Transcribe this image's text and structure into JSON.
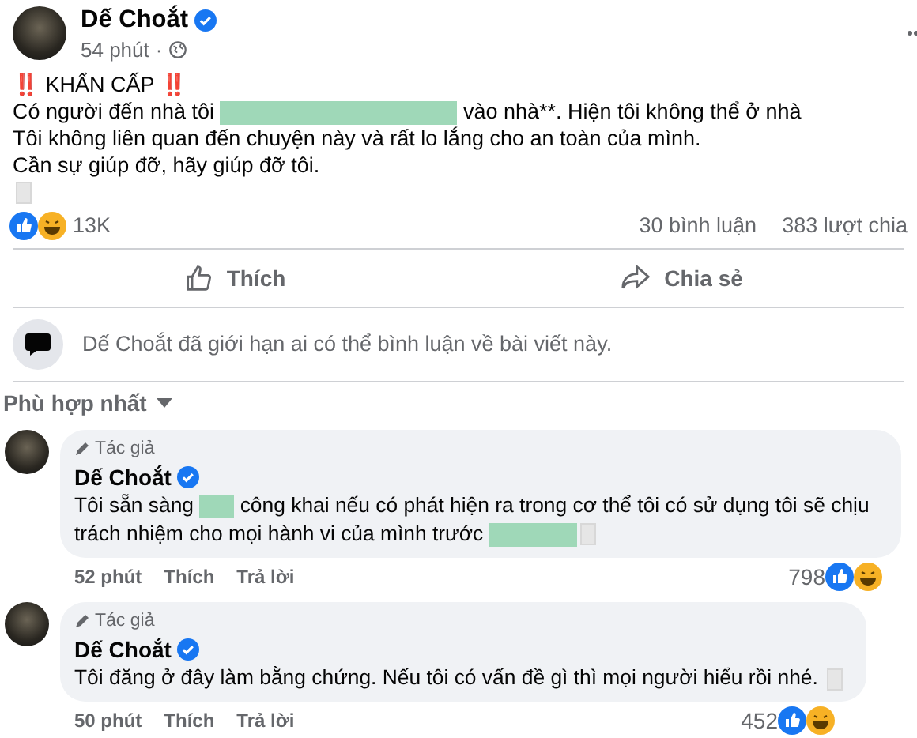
{
  "post": {
    "author": "Dế Choắt",
    "verified": true,
    "time": "54 phút",
    "time_separator": "·",
    "lines": [
      {
        "parts": [
          {
            "kind": "text",
            "text": "‼️ KHẨN CẤP ‼️"
          }
        ]
      },
      {
        "parts": [
          {
            "kind": "text",
            "text": "Có người đến nhà tôi "
          },
          {
            "kind": "redacted"
          },
          {
            "kind": "text",
            "text": " vào nhà**. Hiện tôi không thể ở nhà"
          }
        ]
      },
      {
        "parts": [
          {
            "kind": "text",
            "text": "Tôi không liên quan đến chuyện này và rất lo lắng cho an toàn của mình."
          }
        ]
      },
      {
        "parts": [
          {
            "kind": "text",
            "text": "Cần sự giúp đỡ, hãy giúp đỡ tôi."
          }
        ]
      },
      {
        "parts": [
          {
            "kind": "image"
          }
        ]
      }
    ],
    "reaction_count": "13K",
    "comments_count": "30 bình luận",
    "shares_count": "383 lượt chia",
    "actions": [
      {
        "kind": "like",
        "label": "Thích"
      },
      {
        "kind": "share",
        "label": "Chia sẻ"
      }
    ]
  },
  "restriction_notice": "Dế Choắt đã giới hạn ai có thể bình luận về bài viết này.",
  "sort": {
    "label": "Phù hợp nhất"
  },
  "comments": [
    {
      "badge": "Tác giả",
      "author": "Dế Choắt",
      "verified": true,
      "parts": [
        {
          "kind": "text",
          "text": "Tôi sẵn sàng "
        },
        {
          "kind": "redacted"
        },
        {
          "kind": "text",
          "text": " công khai nếu có phát hiện ra trong cơ thể tôi có sử dụng tôi sẽ chịu trách nhiệm cho mọi hành vi của mình trước "
        },
        {
          "kind": "redacted"
        },
        {
          "kind": "image"
        }
      ],
      "time": "52 phút",
      "like": "Thích",
      "reply": "Trả lời",
      "reactions": "798"
    },
    {
      "badge": "Tác giả",
      "author": "Dế Choắt",
      "verified": true,
      "parts": [
        {
          "kind": "text",
          "text": "Tôi đăng ở đây làm bằng chứng. Nếu tôi có vấn đề gì thì mọi người hiểu rồi nhé. "
        },
        {
          "kind": "image"
        }
      ],
      "time": "50 phút",
      "like": "Thích",
      "reply": "Trả lời",
      "reactions": "452"
    }
  ]
}
